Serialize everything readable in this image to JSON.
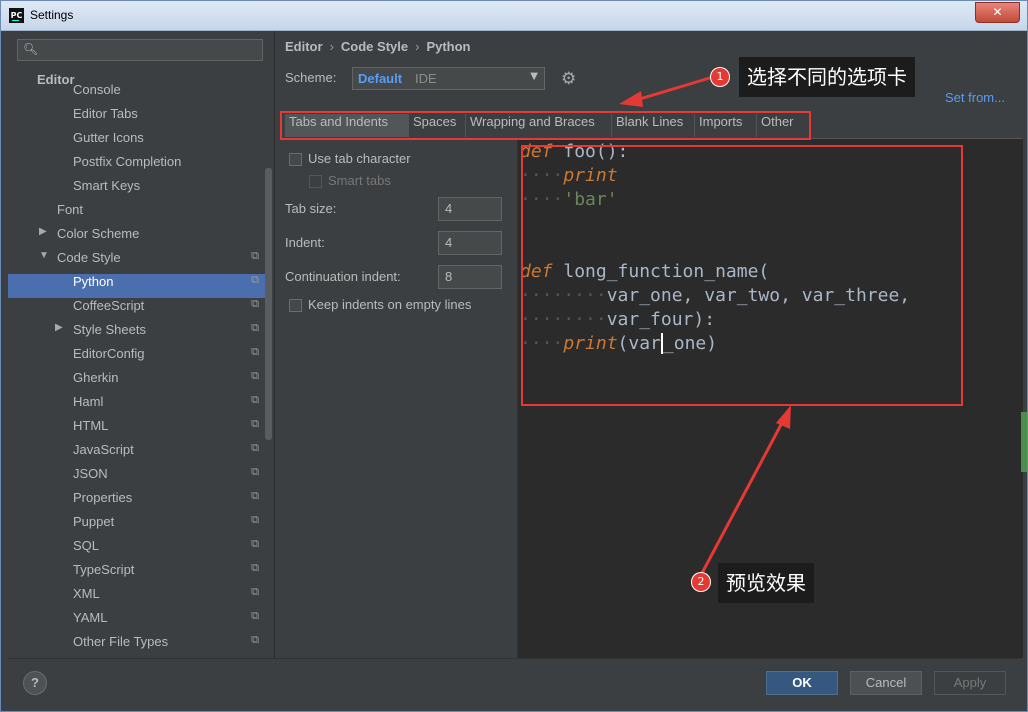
{
  "window": {
    "title": "Settings",
    "logo": "PC"
  },
  "sidebar": {
    "search_placeholder": "",
    "editor_header": "Editor",
    "items": [
      {
        "label": "Console",
        "indent": 2
      },
      {
        "label": "Editor Tabs",
        "indent": 2
      },
      {
        "label": "Gutter Icons",
        "indent": 2
      },
      {
        "label": "Postfix Completion",
        "indent": 2
      },
      {
        "label": "Smart Keys",
        "indent": 2
      },
      {
        "label": "Font",
        "indent": 1
      },
      {
        "label": "Color Scheme",
        "indent": 1,
        "arrow": "▶"
      },
      {
        "label": "Code Style",
        "indent": 1,
        "arrow": "▼",
        "copy": true
      },
      {
        "label": "Python",
        "indent": 2,
        "copy": true,
        "selected": true
      },
      {
        "label": "CoffeeScript",
        "indent": 2,
        "copy": true
      },
      {
        "label": "Style Sheets",
        "indent": 2,
        "copy": true,
        "arrow": "▶"
      },
      {
        "label": "EditorConfig",
        "indent": 2,
        "copy": true
      },
      {
        "label": "Gherkin",
        "indent": 2,
        "copy": true
      },
      {
        "label": "Haml",
        "indent": 2,
        "copy": true
      },
      {
        "label": "HTML",
        "indent": 2,
        "copy": true
      },
      {
        "label": "JavaScript",
        "indent": 2,
        "copy": true
      },
      {
        "label": "JSON",
        "indent": 2,
        "copy": true
      },
      {
        "label": "Properties",
        "indent": 2,
        "copy": true
      },
      {
        "label": "Puppet",
        "indent": 2,
        "copy": true
      },
      {
        "label": "SQL",
        "indent": 2,
        "copy": true
      },
      {
        "label": "TypeScript",
        "indent": 2,
        "copy": true
      },
      {
        "label": "XML",
        "indent": 2,
        "copy": true
      },
      {
        "label": "YAML",
        "indent": 2,
        "copy": true
      },
      {
        "label": "Other File Types",
        "indent": 2,
        "copy": true
      }
    ]
  },
  "breadcrumb": {
    "a": "Editor",
    "b": "Code Style",
    "c": "Python",
    "sep": "›"
  },
  "scheme": {
    "label": "Scheme:",
    "value": "Default",
    "suffix": "IDE",
    "set_from": "Set from..."
  },
  "tabs": [
    "Tabs and Indents",
    "Spaces",
    "Wrapping and Braces",
    "Blank Lines",
    "Imports",
    "Other"
  ],
  "options": {
    "use_tab": "Use tab character",
    "smart_tabs": "Smart tabs",
    "tab_size_label": "Tab size:",
    "tab_size": "4",
    "indent_label": "Indent:",
    "indent": "4",
    "cont_label": "Continuation indent:",
    "cont": "8",
    "keep_indents": "Keep indents on empty lines"
  },
  "code": {
    "l1_kw": "def",
    "l1_rest": " foo():",
    "l2": "print",
    "l3": "'bar'",
    "l5_kw": "def",
    "l5_rest": " long_function_name(",
    "l6": "var_one, var_two, var_three,",
    "l7": "var_four):",
    "l8_fn": "print",
    "l8_a": "(var",
    "l8_b": "_one)"
  },
  "annotations": {
    "callout1": "选择不同的选项卡",
    "callout2": "预览效果",
    "badge1": "1",
    "badge2": "2"
  },
  "buttons": {
    "help": "?",
    "ok": "OK",
    "cancel": "Cancel",
    "apply": "Apply"
  },
  "colors": {
    "accent": "#4b6eaf",
    "annotation": "#e53935",
    "link": "#589df6"
  }
}
